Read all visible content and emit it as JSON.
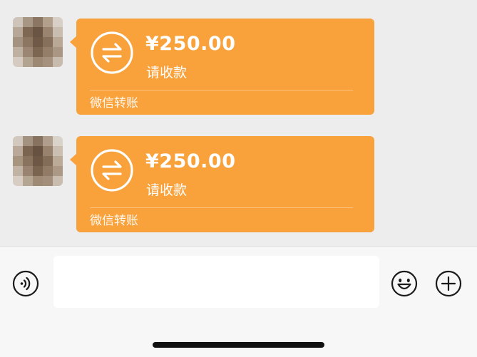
{
  "messages": [
    {
      "amount": "¥250.00",
      "subtitle": "请收款",
      "footer": "微信转账",
      "avatar_icon": "blurred-avatar",
      "icon": "transfer-arrows-icon"
    },
    {
      "amount": "¥250.00",
      "subtitle": "请收款",
      "footer": "微信转账",
      "avatar_icon": "blurred-avatar",
      "icon": "transfer-arrows-icon"
    }
  ],
  "input_bar": {
    "voice_icon": "voice-icon",
    "emoji_icon": "emoji-icon",
    "plus_icon": "plus-icon",
    "message_value": ""
  },
  "colors": {
    "bubble": "#f9a13a",
    "chat_background": "#ededed",
    "input_bar_background": "#f7f7f7"
  }
}
